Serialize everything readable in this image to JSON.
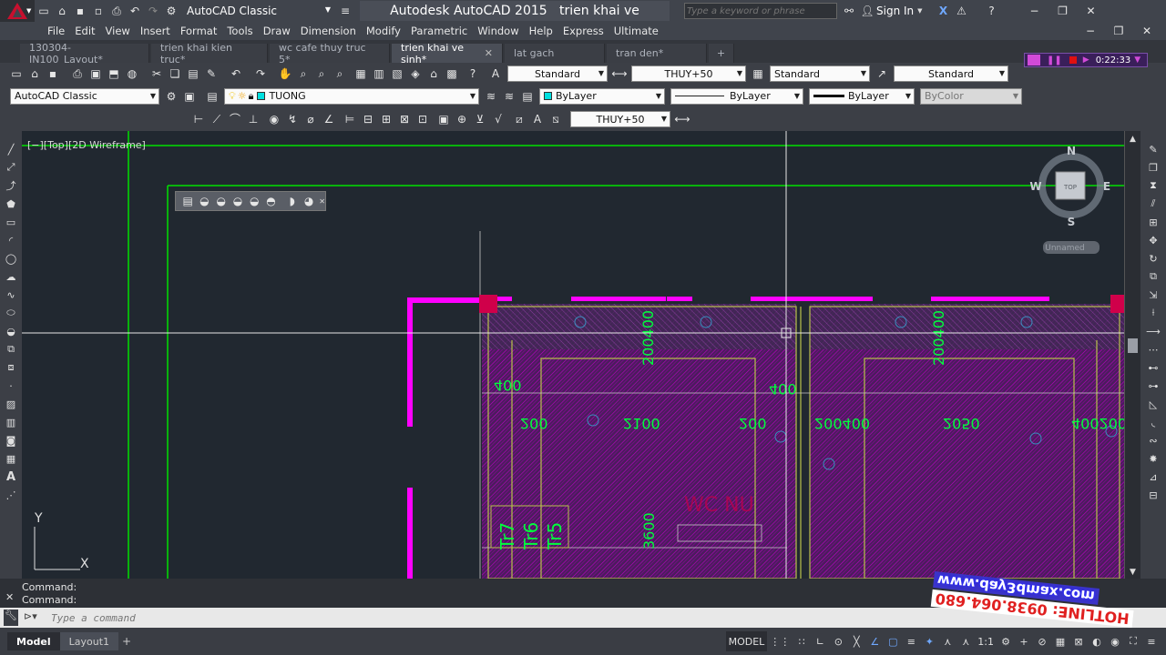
{
  "app": {
    "title": "Autodesk AutoCAD 2015",
    "file_name": "trien khai ve sinh.dwg",
    "workspace": "AutoCAD Classic",
    "search_placeholder": "Type a keyword or phrase",
    "sign_in": "Sign In"
  },
  "menu": [
    "File",
    "Edit",
    "View",
    "Insert",
    "Format",
    "Tools",
    "Draw",
    "Dimension",
    "Modify",
    "Parametric",
    "Window",
    "Help",
    "Express",
    "Ultimate"
  ],
  "tabs": [
    {
      "label": "130304-IN100_Layout*",
      "active": false
    },
    {
      "label": "trien khai kien truc*",
      "active": false
    },
    {
      "label": "wc cafe thuy truc 5*",
      "active": false
    },
    {
      "label": "trien khai ve sinh*",
      "active": true
    },
    {
      "label": "lat gach",
      "active": false
    },
    {
      "label": "tran den*",
      "active": false
    }
  ],
  "recording": {
    "timer": "0:22:33"
  },
  "toolbar1": {
    "text_style": "Standard",
    "dim_style": "THUY+50",
    "table_style": "Standard",
    "mleader_style": "Standard"
  },
  "toolbar2": {
    "workspace": "AutoCAD Classic",
    "layer": "TUONG",
    "color": "ByLayer",
    "linetype": "ByLayer",
    "lineweight": "ByLayer",
    "plotstyle": "ByColor"
  },
  "toolbar3": {
    "dim_style": "THUY+50"
  },
  "viewport": {
    "label": "[−][Top][2D Wireframe]",
    "viewcube": {
      "north": "N",
      "south": "S",
      "east": "E",
      "west": "W",
      "face": "TOP",
      "ucs": "Unnamed"
    },
    "ucs_axes": {
      "x": "X",
      "y": "Y"
    },
    "dims": [
      "200400",
      "200400",
      "400",
      "400",
      "200",
      "2100",
      "200",
      "200400",
      "2050",
      "400200",
      "3600"
    ],
    "room_labels": [
      "Tr7",
      "Tr6",
      "Tr5",
      "WC NU"
    ]
  },
  "command": {
    "history": [
      "Command:",
      "Command:"
    ],
    "placeholder": "Type a command"
  },
  "layout_tabs": [
    "Model",
    "Layout1"
  ],
  "status": {
    "model": "MODEL",
    "scale": "1:1"
  },
  "watermark": {
    "site": "www.day3dmax.com",
    "hotline": "HOTLINE: 0938.064.680"
  },
  "colors": {
    "magenta": "#ff00ff",
    "green": "#00ff00",
    "dark_bg": "#212830",
    "chrome": "#40444c"
  }
}
